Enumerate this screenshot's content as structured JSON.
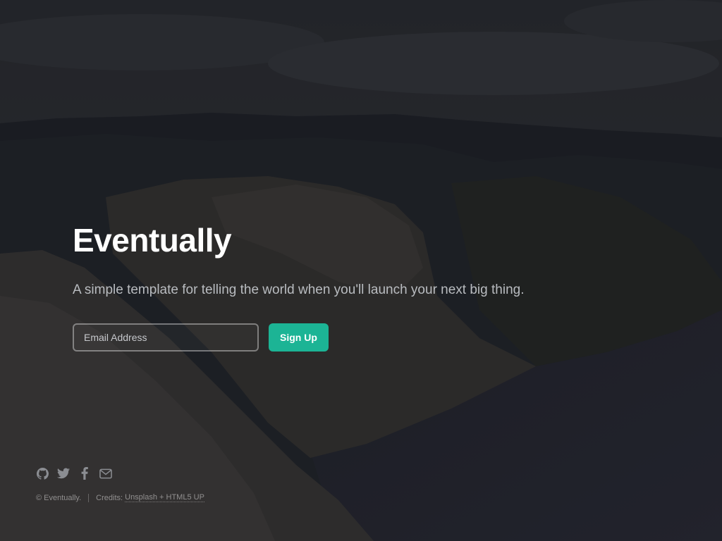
{
  "page": {
    "title": "Eventually",
    "subtitle": "A simple template for telling the world when you'll launch your next big thing."
  },
  "form": {
    "email_placeholder": "Email Address",
    "signup_label": "Sign Up"
  },
  "footer": {
    "icons": [
      "github-icon",
      "twitter-icon",
      "facebook-icon",
      "envelope-icon"
    ],
    "copyright": "© Eventually.",
    "credits_prefix": "Credits:",
    "credits_links": "Unsplash + HTML5 UP"
  },
  "colors": {
    "accent": "#1cb495",
    "title": "#ffffff",
    "subtitle": "#b9bcc0"
  }
}
